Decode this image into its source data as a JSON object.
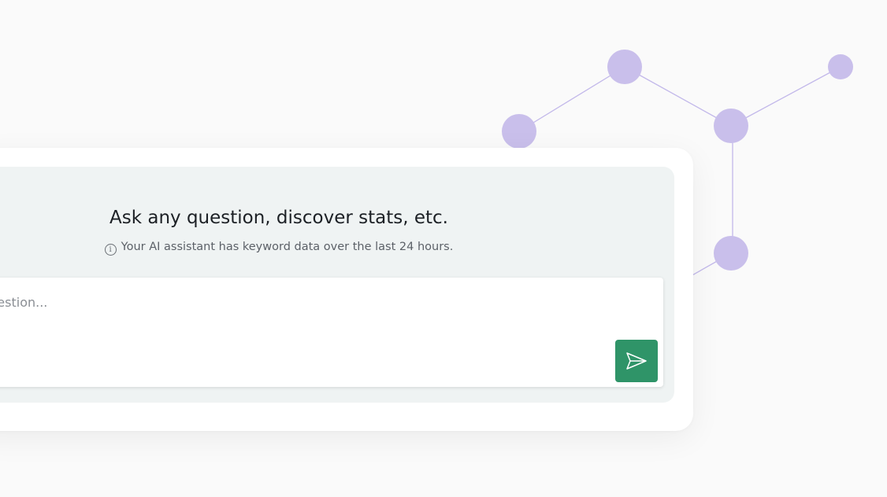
{
  "assistant": {
    "title": "Ask any question, discover stats, etc.",
    "info_text": "Your AI assistant has keyword data over the last 24 hours.",
    "input_placeholder": "question...",
    "send_icon": "send-icon",
    "info_icon": "info-icon"
  },
  "colors": {
    "page_background": "#fafafa",
    "card_background": "#ffffff",
    "panel_background": "#eff3f3",
    "send_button": "#2f9468",
    "network_node": "#c9bfeb",
    "network_line": "#c2b8ea"
  }
}
